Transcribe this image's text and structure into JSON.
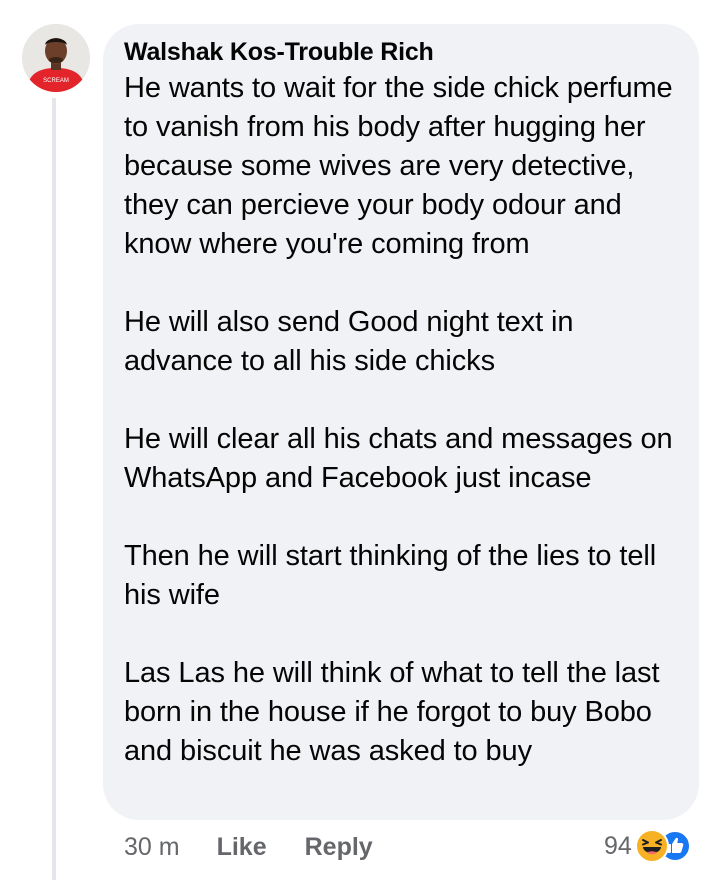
{
  "comment": {
    "author": "Walshak Kos-Trouble Rich",
    "avatar_shirt_text": "SCREAM",
    "paragraphs": [
      "He wants to wait for the side chick perfume to vanish from his body after hugging her because some wives are very detective, they can percieve your body odour and know where you're coming from",
      "He will also send Good night text in advance to all his side chicks",
      "He will clear all his chats and messages on WhatsApp and Facebook just incase",
      "Then he will start thinking of the lies to tell his wife",
      "Las Las he will think of what to tell the last born in the house if he forgot to buy Bobo and biscuit he was asked to buy"
    ]
  },
  "actions": {
    "timestamp": "30 m",
    "like_label": "Like",
    "reply_label": "Reply"
  },
  "reactions": {
    "count": "94",
    "icons": [
      "haha-icon",
      "like-icon"
    ]
  },
  "colors": {
    "bubble_bg": "#f0f2f5",
    "text": "#050505",
    "secondary_text": "#65676b",
    "like_blue": "#1877f2",
    "haha_yellow": "#f7b125",
    "shirt_red": "#e3242b"
  }
}
